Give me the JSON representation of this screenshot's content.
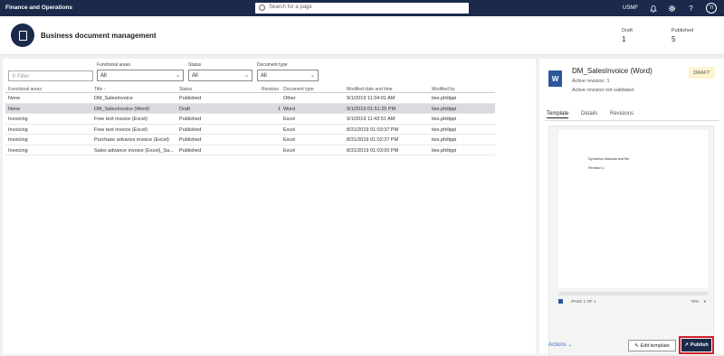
{
  "topbar": {
    "app_title": "Finance and Operations",
    "search_placeholder": "Search for a page",
    "company": "USMF",
    "avatar_initials": "TI"
  },
  "header": {
    "title": "Business document management",
    "draft_label": "Draft",
    "draft_count": "1",
    "published_label": "Published",
    "published_count": "5"
  },
  "filters": {
    "filter_placeholder": "Filter",
    "functional_areas_label": "Functional areas",
    "functional_areas_value": "All",
    "status_label": "Status",
    "status_value": "All",
    "document_type_label": "Document type",
    "document_type_value": "All"
  },
  "grid": {
    "headers": [
      "Functional areas",
      "Title ↑",
      "Status",
      "Revision",
      "Document type",
      "Modified date and time",
      "Modified by"
    ],
    "rows": [
      [
        "None",
        "DM_SalesInvoice",
        "Published",
        "",
        "Other",
        "9/1/2019 11:34:01 AM",
        "ties.philippi"
      ],
      [
        "None",
        "DM_SalesInvoice (Word)",
        "Draft",
        "1",
        "Word",
        "9/1/2019 01:51:25 PM",
        "ties.philippi"
      ],
      [
        "Invoicing",
        "Free text invoice (Excel)",
        "Published",
        "",
        "Excel",
        "9/1/2019 11:43:51 AM",
        "ties.philippi"
      ],
      [
        "Invoicing",
        "Free text invoice (Excel)",
        "Published",
        "",
        "Excel",
        "8/31/2019 01:03:37 PM",
        "ties.philippi"
      ],
      [
        "Invoicing",
        "Purchase advance invoice (Excel)",
        "Published",
        "",
        "Excel",
        "8/31/2019 01:02:37 PM",
        "ties.philippi"
      ],
      [
        "Invoicing",
        "Sales advance invoice (Excel)_Sa...",
        "Published",
        "",
        "Excel",
        "8/31/2019 01:03:00 PM",
        "ties.philippi"
      ]
    ],
    "selected_row": 1
  },
  "details": {
    "title": "DM_SalesInvoice (Word)",
    "active_revision": "Active revision: 1",
    "validation": "Active revision not validated",
    "badge": "DRAFT",
    "tabs": [
      "Template",
      "Details",
      "Revisions"
    ],
    "preview_line1": "Dynamics Manuals test file",
    "preview_line2": "Revision 1",
    "page_indicator": "PAGE 1 OF 1",
    "zoom": "75%",
    "actions_label": "Actions",
    "edit_label": "Edit template",
    "publish_label": "Publish"
  }
}
